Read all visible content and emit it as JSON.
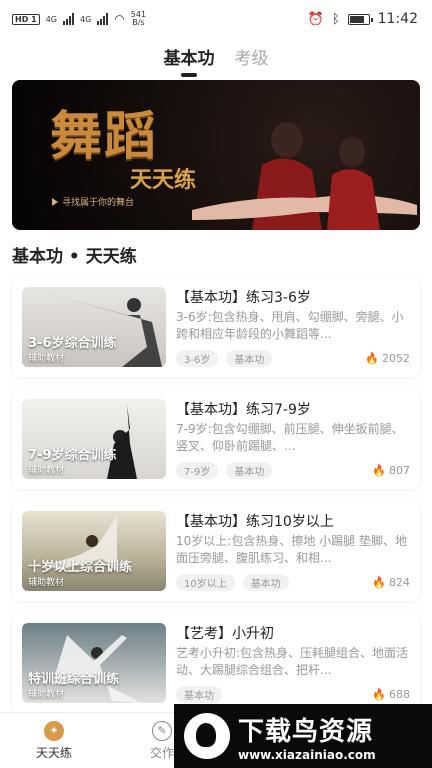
{
  "status_bar": {
    "badge": "HD 1",
    "net1": "4G",
    "net2": "4G",
    "speed_value": "541",
    "speed_unit": "B/s",
    "time": "11:42"
  },
  "top_tabs": [
    {
      "label": "基本功",
      "active": true
    },
    {
      "label": "考级",
      "active": false
    }
  ],
  "banner": {
    "title": "舞蹈",
    "subtitle": "天天练",
    "slogan": "寻找属于你的舞台"
  },
  "section_title": "基本功 • 天天练",
  "courses": [
    {
      "thumb_title": "3-6岁综合训练",
      "thumb_sub": "辅助教材",
      "title": "【基本功】练习3-6岁",
      "desc": "3-6岁:包含热身、甩肩、勾绷脚、旁腿、小跨和相应年龄段的小舞蹈等...",
      "tags": [
        "3-6岁",
        "基本功"
      ],
      "heat": "2052"
    },
    {
      "thumb_title": "7-9岁综合训练",
      "thumb_sub": "辅助教材",
      "title": "【基本功】练习7-9岁",
      "desc": "7-9岁:包含勾绷脚、前压腿、伸坐扳前腿、竖叉、仰卧前踢腿、...",
      "tags": [
        "7-9岁",
        "基本功"
      ],
      "heat": "807"
    },
    {
      "thumb_title": "十岁以上综合训练",
      "thumb_sub": "辅助教材",
      "title": "【基本功】练习10岁以上",
      "desc": "10岁以上:包含热身、擦地 小踢腿 垫脚、地面压旁腿、腹肌练习、和相...",
      "tags": [
        "10岁以上",
        "基本功"
      ],
      "heat": "824"
    },
    {
      "thumb_title": "特训班综合训练",
      "thumb_sub": "辅助教材",
      "title": "【艺考】小升初",
      "desc": "艺考小升初:包含热身、压耗腿组合、地面活动、大踢腿综合组合、把杆...",
      "tags": [
        "基本功"
      ],
      "heat": "688"
    }
  ],
  "bottom_nav": [
    {
      "label": "天天练",
      "icon": "dance-icon",
      "active": true
    },
    {
      "label": "交作",
      "icon": "edit-icon",
      "active": false
    }
  ],
  "watermark": {
    "text": "下载鸟资源",
    "url": "www.xiazainiao.com"
  },
  "colors": {
    "accent": "#d89a4a",
    "flame": "#ff6a3d",
    "banner_gold": "#c98a3c"
  }
}
